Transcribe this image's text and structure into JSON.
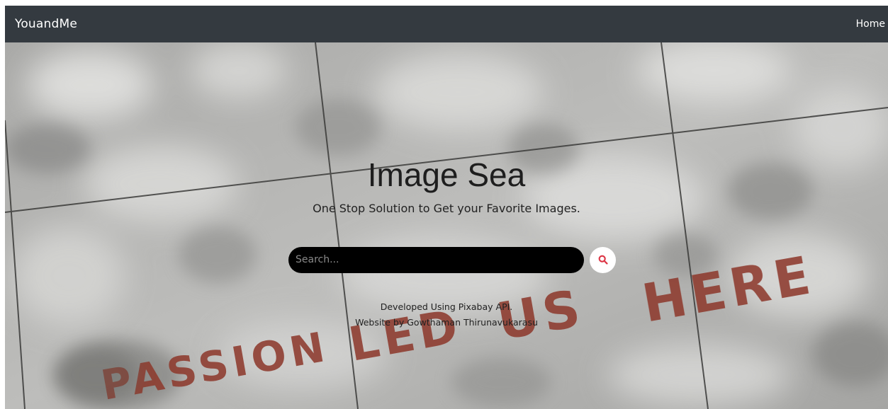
{
  "navbar": {
    "brand": "YouandMe",
    "links": [
      {
        "label": "Home"
      }
    ]
  },
  "hero": {
    "title": "Image Sea",
    "subtitle": "One Stop Solution to Get your Favorite Images.",
    "background_text": "PASSION LED US HERE",
    "search": {
      "placeholder": "Search...",
      "value": "",
      "button_icon": "search-icon"
    },
    "footer_lines": [
      "Developed Using Pixabay API.",
      "Website by Gowthaman Thirunavukarasu"
    ]
  },
  "colors": {
    "navbar_bg": "#343a40",
    "search_bg": "#000000",
    "search_icon": "#dc3545",
    "painted_text": "#8e3b2e"
  }
}
